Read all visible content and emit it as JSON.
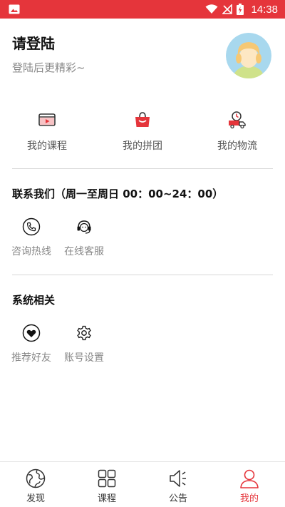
{
  "status_bar": {
    "time": "14:38",
    "color": "#e5353b"
  },
  "profile": {
    "title": "请登陆",
    "subtitle": "登陆后更精彩~"
  },
  "quick_actions": [
    {
      "label": "我的课程",
      "icon": "video-course-icon"
    },
    {
      "label": "我的拼团",
      "icon": "shopping-bag-icon"
    },
    {
      "label": "我的物流",
      "icon": "delivery-truck-icon"
    }
  ],
  "contact": {
    "title": "联系我们（周一至周日 00：00~24：00）",
    "items": [
      {
        "label": "咨询热线",
        "icon": "phone-icon"
      },
      {
        "label": "在线客服",
        "icon": "headset-icon"
      }
    ]
  },
  "system": {
    "title": "系统相关",
    "items": [
      {
        "label": "推荐好友",
        "icon": "heart-icon"
      },
      {
        "label": "账号设置",
        "icon": "gear-icon"
      }
    ]
  },
  "bottom_nav": {
    "active_color": "#e5353b",
    "items": [
      {
        "label": "发现",
        "icon": "globe-icon"
      },
      {
        "label": "课程",
        "icon": "grid-icon"
      },
      {
        "label": "公告",
        "icon": "speaker-icon"
      },
      {
        "label": "我的",
        "icon": "user-icon",
        "active": true
      }
    ]
  }
}
